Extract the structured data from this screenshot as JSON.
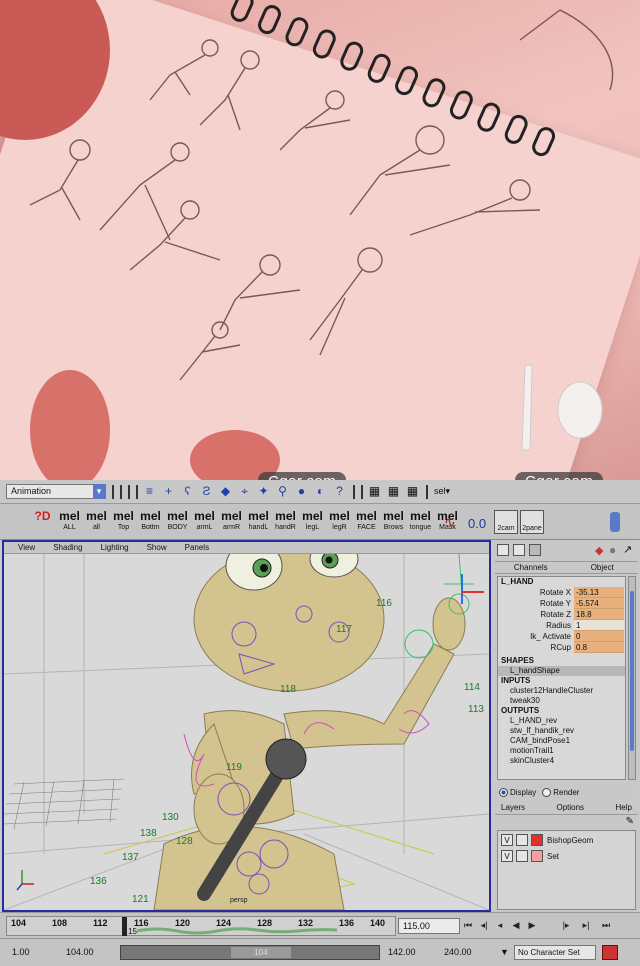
{
  "watermark": {
    "left": "Cger.com",
    "right": "Cger.com"
  },
  "statusline": {
    "mode": "Animation",
    "sel_label": "sel▾"
  },
  "shelf": {
    "buttons": [
      {
        "glyph": "?D",
        "label": ""
      },
      {
        "glyph": "mel",
        "label": "ALL"
      },
      {
        "glyph": "mel",
        "label": "all"
      },
      {
        "glyph": "mel",
        "label": "Top"
      },
      {
        "glyph": "mel",
        "label": "Bottm"
      },
      {
        "glyph": "mel",
        "label": "BODY"
      },
      {
        "glyph": "mel",
        "label": "armL"
      },
      {
        "glyph": "mel",
        "label": "armR"
      },
      {
        "glyph": "mel",
        "label": "handL"
      },
      {
        "glyph": "mel",
        "label": "handR"
      },
      {
        "glyph": "mel",
        "label": "legL"
      },
      {
        "glyph": "mel",
        "label": "legR"
      },
      {
        "glyph": "mel",
        "label": "FACE"
      },
      {
        "glyph": "mel",
        "label": "Brows"
      },
      {
        "glyph": "mel",
        "label": "tongue"
      },
      {
        "glyph": "mel",
        "label": "Mask"
      }
    ],
    "value": "0.0",
    "cam_label": "2cam",
    "pane_label": "2pane"
  },
  "viewport": {
    "menu": [
      "View",
      "Shading",
      "Lighting",
      "Show",
      "Panels"
    ],
    "camera": "persp",
    "frame_labels": [
      "116",
      "117",
      "118",
      "114",
      "113",
      "119",
      "130",
      "138",
      "128",
      "137",
      "136",
      "121"
    ]
  },
  "channelbox": {
    "tabs": [
      "Channels",
      "Object"
    ],
    "node": "L_HAND",
    "attributes": [
      {
        "name": "Rotate X",
        "value": "-35.13",
        "keyed": true
      },
      {
        "name": "Rotate Y",
        "value": "-5.574",
        "keyed": true
      },
      {
        "name": "Rotate Z",
        "value": "18.8",
        "keyed": true
      },
      {
        "name": "Radius",
        "value": "1",
        "keyed": false
      },
      {
        "name": "Ik_ Activate",
        "value": "0",
        "keyed": true
      },
      {
        "name": "RCup",
        "value": "0.8",
        "keyed": true
      }
    ],
    "shapes_header": "SHAPES",
    "shapes": [
      "L_handShape"
    ],
    "inputs_header": "INPUTS",
    "inputs": [
      "cluster12HandleCluster",
      "tweak30"
    ],
    "outputs_header": "OUTPUTS",
    "outputs": [
      "L_HAND_rev",
      "stw_lf_handik_rev",
      "CAM_bindPose1",
      "motionTrail1",
      "skinCluster4"
    ]
  },
  "layers": {
    "display": "Display",
    "render": "Render",
    "menu": [
      "Layers",
      "Options",
      "Help"
    ],
    "rows": [
      {
        "v": "V",
        "name": "BishopGeom",
        "color": "#e23030"
      },
      {
        "v": "V",
        "name": "Set",
        "color": "#f2a0a0"
      }
    ]
  },
  "timeslider": {
    "ticks": [
      "104",
      "108",
      "112",
      "116",
      "120",
      "124",
      "128",
      "132",
      "136",
      "140"
    ],
    "current_frame": "115.00",
    "current_index_label": "15"
  },
  "rangeslider": {
    "start": "1.00",
    "range_start": "104.00",
    "handle_label": "104",
    "range_end": "142.00",
    "end": "240.00",
    "character_set": "No Character Set"
  }
}
